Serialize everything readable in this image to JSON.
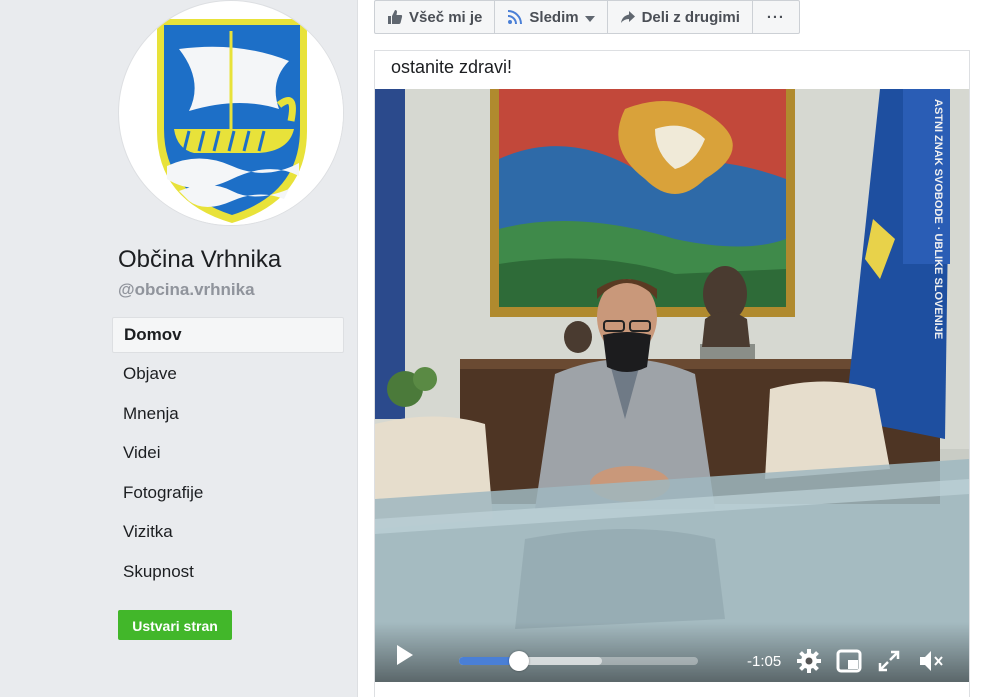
{
  "sidebar": {
    "page_name": "Občina Vrhnika",
    "handle": "@obcina.vrhnika",
    "nav": [
      {
        "label": "Domov",
        "active": true
      },
      {
        "label": "Objave",
        "active": false
      },
      {
        "label": "Mnenja",
        "active": false
      },
      {
        "label": "Videi",
        "active": false
      },
      {
        "label": "Fotografije",
        "active": false
      },
      {
        "label": "Vizitka",
        "active": false
      },
      {
        "label": "Skupnost",
        "active": false
      }
    ],
    "create_page_label": "Ustvari stran"
  },
  "actions": {
    "like_label": "Všeč mi je",
    "follow_label": "Sledim",
    "share_label": "Deli z drugimi",
    "more_label": "···"
  },
  "post": {
    "text": "ostanite zdravi!"
  },
  "video": {
    "time_remaining": "-1:05",
    "progress_played": 0.25,
    "progress_buffered": 0.6,
    "flag_text": "ASTNI ZNAK SVOBODE · UBLIKE SLOVENIJE"
  },
  "colors": {
    "accent_blue": "#4a7fd6",
    "create_green": "#42b72a",
    "sidebar_bg": "#e9ebee"
  },
  "icons": {
    "like": "thumbs-up-icon",
    "follow": "rss-icon",
    "share": "share-arrow-icon",
    "play": "play-icon",
    "settings": "gear-icon",
    "pip": "picture-in-picture-icon",
    "fullscreen": "fullscreen-icon",
    "mute": "muted-speaker-icon"
  }
}
